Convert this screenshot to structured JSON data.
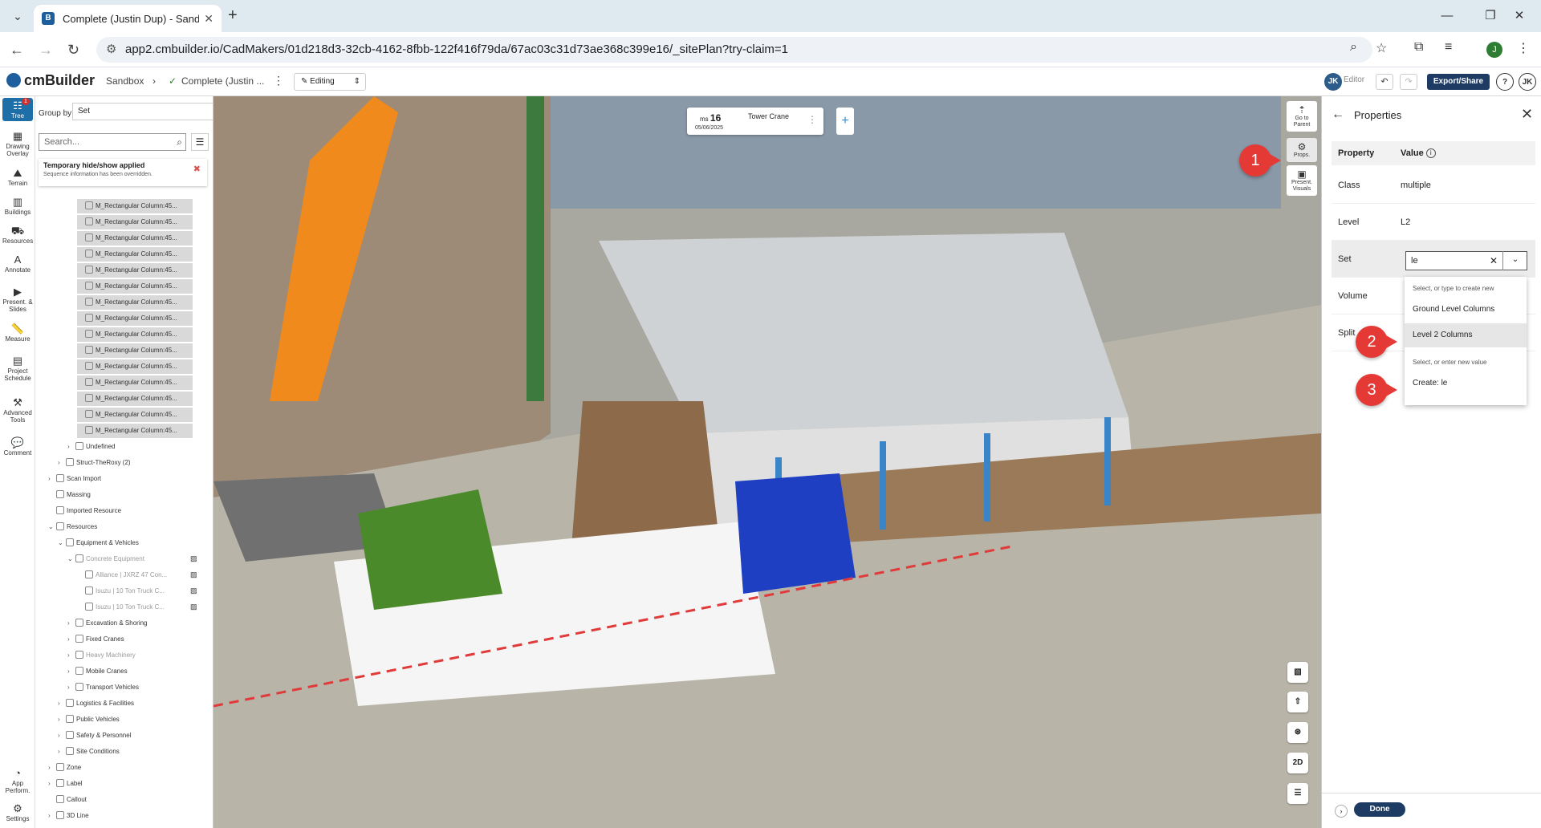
{
  "browser": {
    "tab_title": "Complete (Justin Dup) - Sandbo",
    "url": "app2.cmbuilder.io/CadMakers/01d218d3-32cb-4162-8fbb-122f416f79da/67ac03c31d73ae368c399e16/_sitePlan?try-claim=1",
    "profile_initial": "J"
  },
  "header": {
    "logo": "cmBuilder",
    "crumb1": "Sandbox",
    "crumb2": "Complete (Justin ...",
    "mode": "Editing",
    "user_initials": "JK",
    "role": "Editor",
    "export_label": "Export/Share",
    "help": "?"
  },
  "rail": {
    "items": [
      {
        "label": "Tree",
        "icon": "tree-icon"
      },
      {
        "label": "Drawing Overlay",
        "icon": "drawing-icon"
      },
      {
        "label": "Terrain",
        "icon": "terrain-icon"
      },
      {
        "label": "Buildings",
        "icon": "buildings-icon"
      },
      {
        "label": "Resources",
        "icon": "resources-icon"
      },
      {
        "label": "Annotate",
        "icon": "annotate-icon"
      },
      {
        "label": "Present. & Slides",
        "icon": "present-icon"
      },
      {
        "label": "Measure",
        "icon": "measure-icon"
      },
      {
        "label": "Project Schedule",
        "icon": "schedule-icon"
      },
      {
        "label": "Advanced Tools",
        "icon": "tools-icon"
      },
      {
        "label": "Comment",
        "icon": "comment-icon"
      },
      {
        "label": "App Perform.",
        "icon": "performance-icon"
      },
      {
        "label": "Settings",
        "icon": "gear-icon"
      }
    ],
    "tree_badge": "1"
  },
  "tree": {
    "group_by_label": "Group by",
    "group_by_value": "Set",
    "search_placeholder": "Search...",
    "notice_title": "Temporary hide/show applied",
    "notice_sub": "Sequence information has been overridden.",
    "rows": [
      {
        "label": "M_Rectangular Column:45...",
        "level": 4,
        "hl": true
      },
      {
        "label": "M_Rectangular Column:45...",
        "level": 4,
        "hl": true
      },
      {
        "label": "M_Rectangular Column:45...",
        "level": 4,
        "hl": true
      },
      {
        "label": "M_Rectangular Column:45...",
        "level": 4,
        "hl": true
      },
      {
        "label": "M_Rectangular Column:45...",
        "level": 4,
        "hl": true
      },
      {
        "label": "M_Rectangular Column:45...",
        "level": 4,
        "hl": true
      },
      {
        "label": "M_Rectangular Column:45...",
        "level": 4,
        "hl": true
      },
      {
        "label": "M_Rectangular Column:45...",
        "level": 4,
        "hl": true
      },
      {
        "label": "M_Rectangular Column:45...",
        "level": 4,
        "hl": true
      },
      {
        "label": "M_Rectangular Column:45...",
        "level": 4,
        "hl": true
      },
      {
        "label": "M_Rectangular Column:45...",
        "level": 4,
        "hl": true
      },
      {
        "label": "M_Rectangular Column:45...",
        "level": 4,
        "hl": true
      },
      {
        "label": "M_Rectangular Column:45...",
        "level": 4,
        "hl": true
      },
      {
        "label": "M_Rectangular Column:45...",
        "level": 4,
        "hl": true
      },
      {
        "label": "M_Rectangular Column:45...",
        "level": 4,
        "hl": true
      },
      {
        "label": "Undefined",
        "level": 3,
        "chev": "›"
      },
      {
        "label": "Struct-TheRoxy (2)",
        "level": 2,
        "chev": "›"
      },
      {
        "label": "Scan Import",
        "level": 1,
        "chev": "›"
      },
      {
        "label": "Massing",
        "level": 1
      },
      {
        "label": "Imported Resource",
        "level": 1
      },
      {
        "label": "Resources",
        "level": 1,
        "chev": "⌄"
      },
      {
        "label": "Equipment & Vehicles",
        "level": 2,
        "chev": "⌄"
      },
      {
        "label": "Concrete Equipment",
        "level": 3,
        "chev": "⌄",
        "dim": true,
        "eye": true
      },
      {
        "label": "Alliance | JXRZ 47 Con...",
        "level": 4,
        "dim": true,
        "eye": true
      },
      {
        "label": "Isuzu | 10 Ton Truck C...",
        "level": 4,
        "dim": true,
        "eye": true
      },
      {
        "label": "Isuzu | 10 Ton Truck C...",
        "level": 4,
        "dim": true,
        "eye": true
      },
      {
        "label": "Excavation & Shoring",
        "level": 3,
        "chev": "›"
      },
      {
        "label": "Fixed Cranes",
        "level": 3,
        "chev": "›"
      },
      {
        "label": "Heavy Machinery",
        "level": 3,
        "chev": "›",
        "dim": true
      },
      {
        "label": "Mobile Cranes",
        "level": 3,
        "chev": "›"
      },
      {
        "label": "Transport Vehicles",
        "level": 3,
        "chev": "›"
      },
      {
        "label": "Logistics & Facilities",
        "level": 2,
        "chev": "›"
      },
      {
        "label": "Public Vehicles",
        "level": 2,
        "chev": "›"
      },
      {
        "label": "Safety & Personnel",
        "level": 2,
        "chev": "›"
      },
      {
        "label": "Site Conditions",
        "level": 2,
        "chev": "›"
      },
      {
        "label": "Zone",
        "level": 1,
        "chev": "›"
      },
      {
        "label": "Label",
        "level": 1,
        "chev": "›"
      },
      {
        "label": "Callout",
        "level": 1
      },
      {
        "label": "3D Line",
        "level": 1,
        "chev": "›"
      }
    ]
  },
  "viewport": {
    "seq_ms": "ms",
    "seq_num": "16",
    "seq_date": "05/06/2025",
    "seq_name": "Tower Crane",
    "tools": [
      {
        "label": "Go to Parent",
        "icon": "parent-icon"
      },
      {
        "label": "Props.",
        "icon": "props-icon"
      },
      {
        "label": "Present. Visuals",
        "icon": "visuals-icon"
      }
    ],
    "view_2d": "2D",
    "annotations": [
      "1",
      "2",
      "3"
    ]
  },
  "properties": {
    "title": "Properties",
    "col_property": "Property",
    "col_value": "Value",
    "rows": [
      {
        "key": "Class",
        "value": "multiple"
      },
      {
        "key": "Level",
        "value": "L2"
      },
      {
        "key": "Set",
        "value": ""
      },
      {
        "key": "Volume",
        "value": ""
      },
      {
        "key": "Split",
        "value": ""
      }
    ],
    "set_input": "le",
    "dropdown_hint1": "Select, or type to create new",
    "option1": "Ground Level Columns",
    "option2": "Level 2 Columns",
    "dropdown_hint2": "Select, or enter new value",
    "option3": "Create: le",
    "done_label": "Done"
  }
}
